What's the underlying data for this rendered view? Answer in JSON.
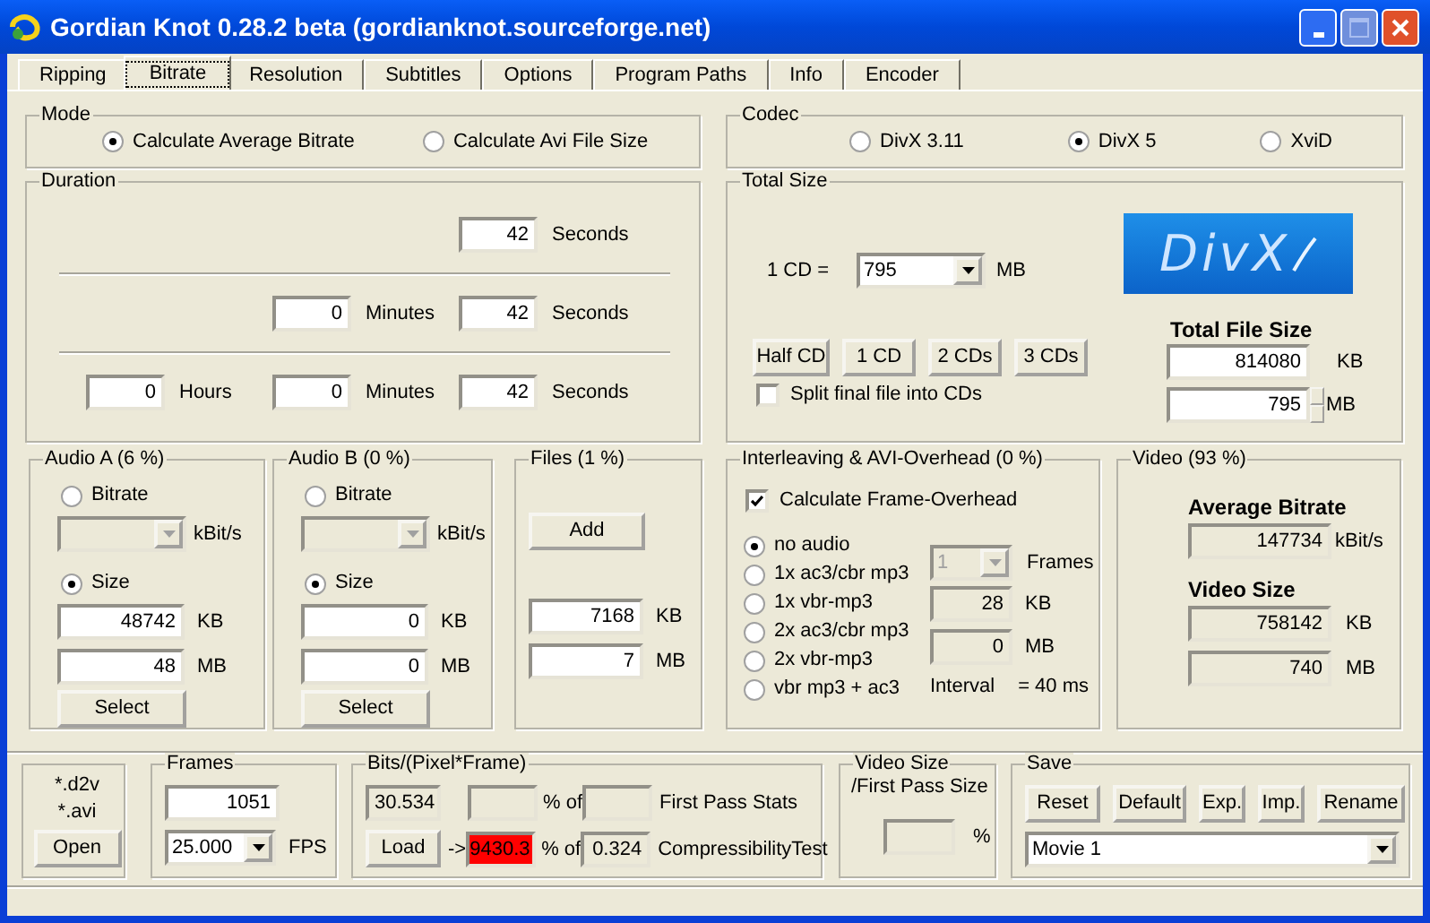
{
  "window": {
    "title": "Gordian Knot 0.28.2 beta (gordianknot.sourceforge.net)"
  },
  "tabs": [
    {
      "label": "Ripping",
      "selected": false
    },
    {
      "label": "Bitrate",
      "selected": true
    },
    {
      "label": "Resolution",
      "selected": false
    },
    {
      "label": "Subtitles",
      "selected": false
    },
    {
      "label": "Options",
      "selected": false
    },
    {
      "label": "Program Paths",
      "selected": false
    },
    {
      "label": "Info",
      "selected": false
    },
    {
      "label": "Encoder",
      "selected": false
    }
  ],
  "mode": {
    "title": "Mode",
    "options": [
      {
        "label": "Calculate Average Bitrate",
        "selected": true
      },
      {
        "label": "Calculate Avi File Size",
        "selected": false
      }
    ]
  },
  "codec": {
    "title": "Codec",
    "options": [
      {
        "label": "DivX 3.11",
        "selected": false
      },
      {
        "label": "DivX 5",
        "selected": true
      },
      {
        "label": "XviD",
        "selected": false
      }
    ]
  },
  "duration": {
    "title": "Duration",
    "rows": [
      {
        "seconds": {
          "value": "42",
          "unit": "Seconds"
        }
      },
      {
        "minutes": {
          "value": "0",
          "unit": "Minutes"
        },
        "seconds": {
          "value": "42",
          "unit": "Seconds"
        }
      },
      {
        "hours": {
          "value": "0",
          "unit": "Hours"
        },
        "minutes": {
          "value": "0",
          "unit": "Minutes"
        },
        "seconds": {
          "value": "42",
          "unit": "Seconds"
        }
      }
    ]
  },
  "total_size": {
    "title": "Total Size",
    "cd_label": "1 CD =",
    "cd_value": "795",
    "cd_unit": "MB",
    "logo_text": "DivX",
    "buttons": [
      "Half CD",
      "1 CD",
      "2 CDs",
      "3 CDs"
    ],
    "split": {
      "label": "Split final file into CDs",
      "checked": false
    },
    "file_size_heading": "Total File Size",
    "kb": "814080",
    "kb_unit": "KB",
    "mb": "795",
    "mb_unit": "MB"
  },
  "audio": [
    {
      "title": "Audio A (6 %)",
      "options": [
        {
          "label": "Bitrate",
          "selected": false
        },
        {
          "label": "Size",
          "selected": true
        }
      ],
      "rate_unit": "kBit/s",
      "kb": "48742",
      "kb_unit": "KB",
      "mb": "48",
      "mb_unit": "MB",
      "button": "Select"
    },
    {
      "title": "Audio B (0 %)",
      "options": [
        {
          "label": "Bitrate",
          "selected": false
        },
        {
          "label": "Size",
          "selected": true
        }
      ],
      "rate_unit": "kBit/s",
      "kb": "0",
      "kb_unit": "KB",
      "mb": "0",
      "mb_unit": "MB",
      "button": "Select"
    }
  ],
  "files": {
    "title": "Files (1 %)",
    "button": "Add",
    "kb": "7168",
    "kb_unit": "KB",
    "mb": "7",
    "mb_unit": "MB"
  },
  "interleaving": {
    "title": "Interleaving & AVI-Overhead (0 %)",
    "calculate": {
      "label": "Calculate  Frame-Overhead",
      "checked": true
    },
    "options": [
      {
        "label": "no audio",
        "selected": true
      },
      {
        "label": "1x ac3/cbr mp3",
        "selected": false
      },
      {
        "label": "1x vbr-mp3",
        "selected": false
      },
      {
        "label": "2x ac3/cbr mp3",
        "selected": false
      },
      {
        "label": "2x vbr-mp3",
        "selected": false
      },
      {
        "label": "vbr mp3 + ac3",
        "selected": false
      }
    ],
    "frames_value": "1",
    "frames_unit": "Frames",
    "kb": "28",
    "kb_unit": "KB",
    "mb": "0",
    "mb_unit": "MB",
    "interval_label": "Interval",
    "interval_value": "= 40 ms"
  },
  "video": {
    "title": "Video (93 %)",
    "bitrate_heading": "Average Bitrate",
    "bitrate": "147734",
    "bitrate_unit": "kBit/s",
    "size_heading": "Video Size",
    "kb": "758142",
    "kb_unit": "KB",
    "mb": "740",
    "mb_unit": "MB"
  },
  "open": {
    "types": [
      "*.d2v",
      "*.avi"
    ],
    "button": "Open"
  },
  "frames": {
    "title": "Frames",
    "value": "1051",
    "fps": "25.000",
    "fps_unit": "FPS"
  },
  "bits": {
    "title": "Bits/(Pixel*Frame)",
    "value": "30.534",
    "percent_of": "% of",
    "first_pass_label": "First Pass Stats",
    "load_button": "Load",
    "arrow": "->",
    "compress_percent": "9430.3",
    "compress_alert": true,
    "percent_of_2": "% of",
    "compress_value": "0.324",
    "compress_label": "CompressibilityTest"
  },
  "video_ratio": {
    "title_lines": [
      "Video Size",
      "/First Pass Size"
    ],
    "unit": "%"
  },
  "save": {
    "title": "Save",
    "buttons": [
      "Reset",
      "Default",
      "Exp.",
      "Imp.",
      "Rename"
    ],
    "preset": "Movie 1"
  }
}
